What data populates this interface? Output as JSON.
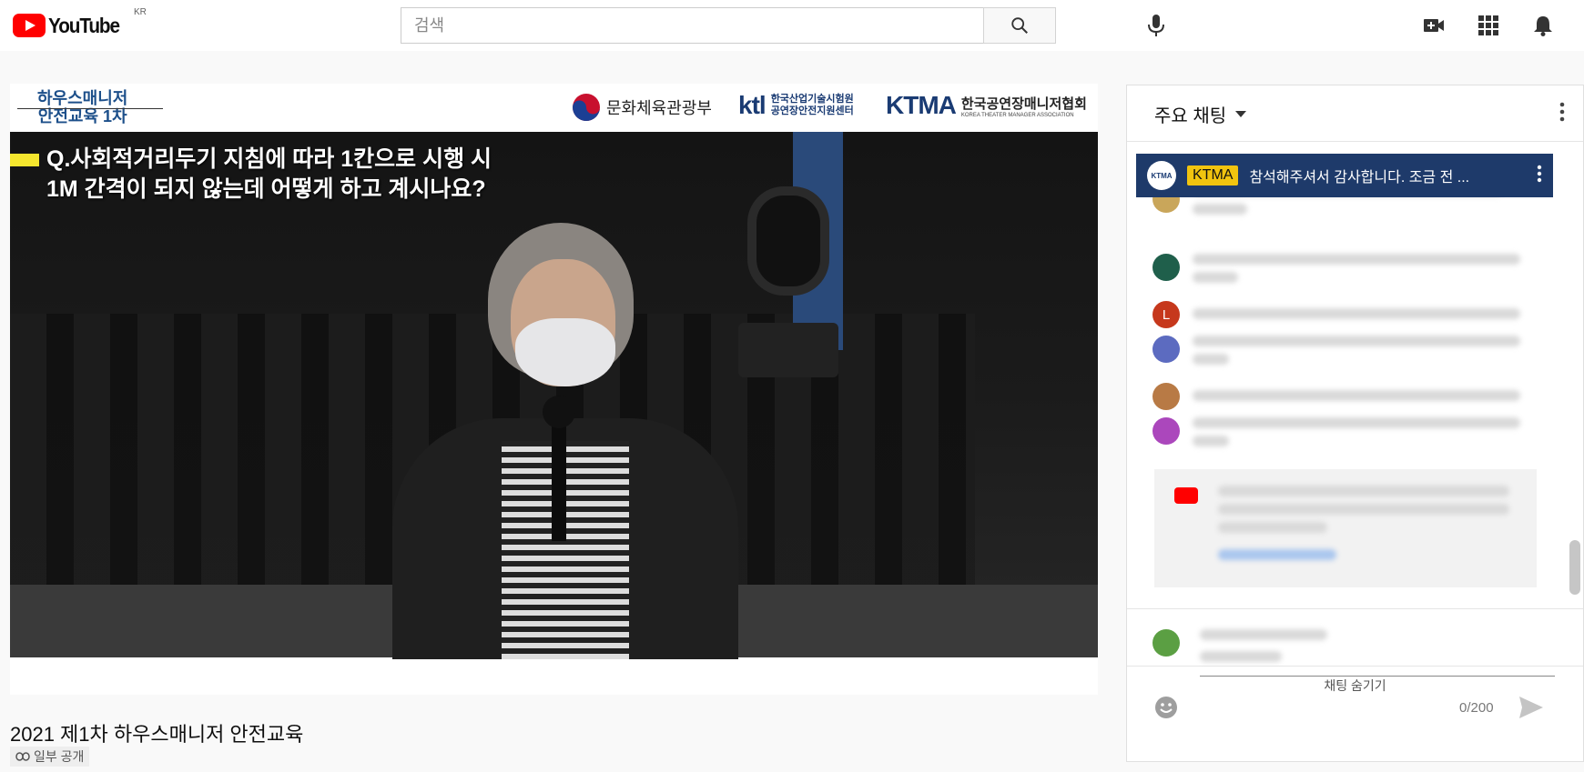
{
  "header": {
    "logo_text": "YouTube",
    "country_code": "KR",
    "search_placeholder": "검색"
  },
  "video": {
    "banner_course_line1": "하우스매니저",
    "banner_course_line2": "안전교육 1차",
    "org1": "문화체육관광부",
    "org2_mark": "ktl",
    "org2_line1": "한국산업기술시험원",
    "org2_line2": "공연장안전지원센터",
    "org3_mark": "KTMA",
    "org3_line1": "한국공연장매니저협회",
    "org3_line2": "KOREA THEATER MANAGER ASSOCIATION",
    "question_line1": "Q.사회적거리두기 지침에 따라 1칸으로 시행 시",
    "question_line2": "1M 간격이 되지 않는데 어떻게 하고 계시나요?"
  },
  "below": {
    "title": "2021 제1차 하우스매니저 안전교육",
    "privacy": "일부 공개"
  },
  "chat": {
    "mode": "주요 채팅",
    "pinned_badge": "KTMA",
    "pinned_message": "참석해주셔서 감사합니다. 조금 전 ...",
    "pinned_avatar": "KTMA",
    "avatar_letter": "L",
    "counter": "0/200",
    "hide_label": "채팅 숨기기",
    "colors": {
      "pinned_bg": "#1e3a6a",
      "badge_bg": "#f1c40f",
      "brand_red": "#ff0000"
    }
  }
}
